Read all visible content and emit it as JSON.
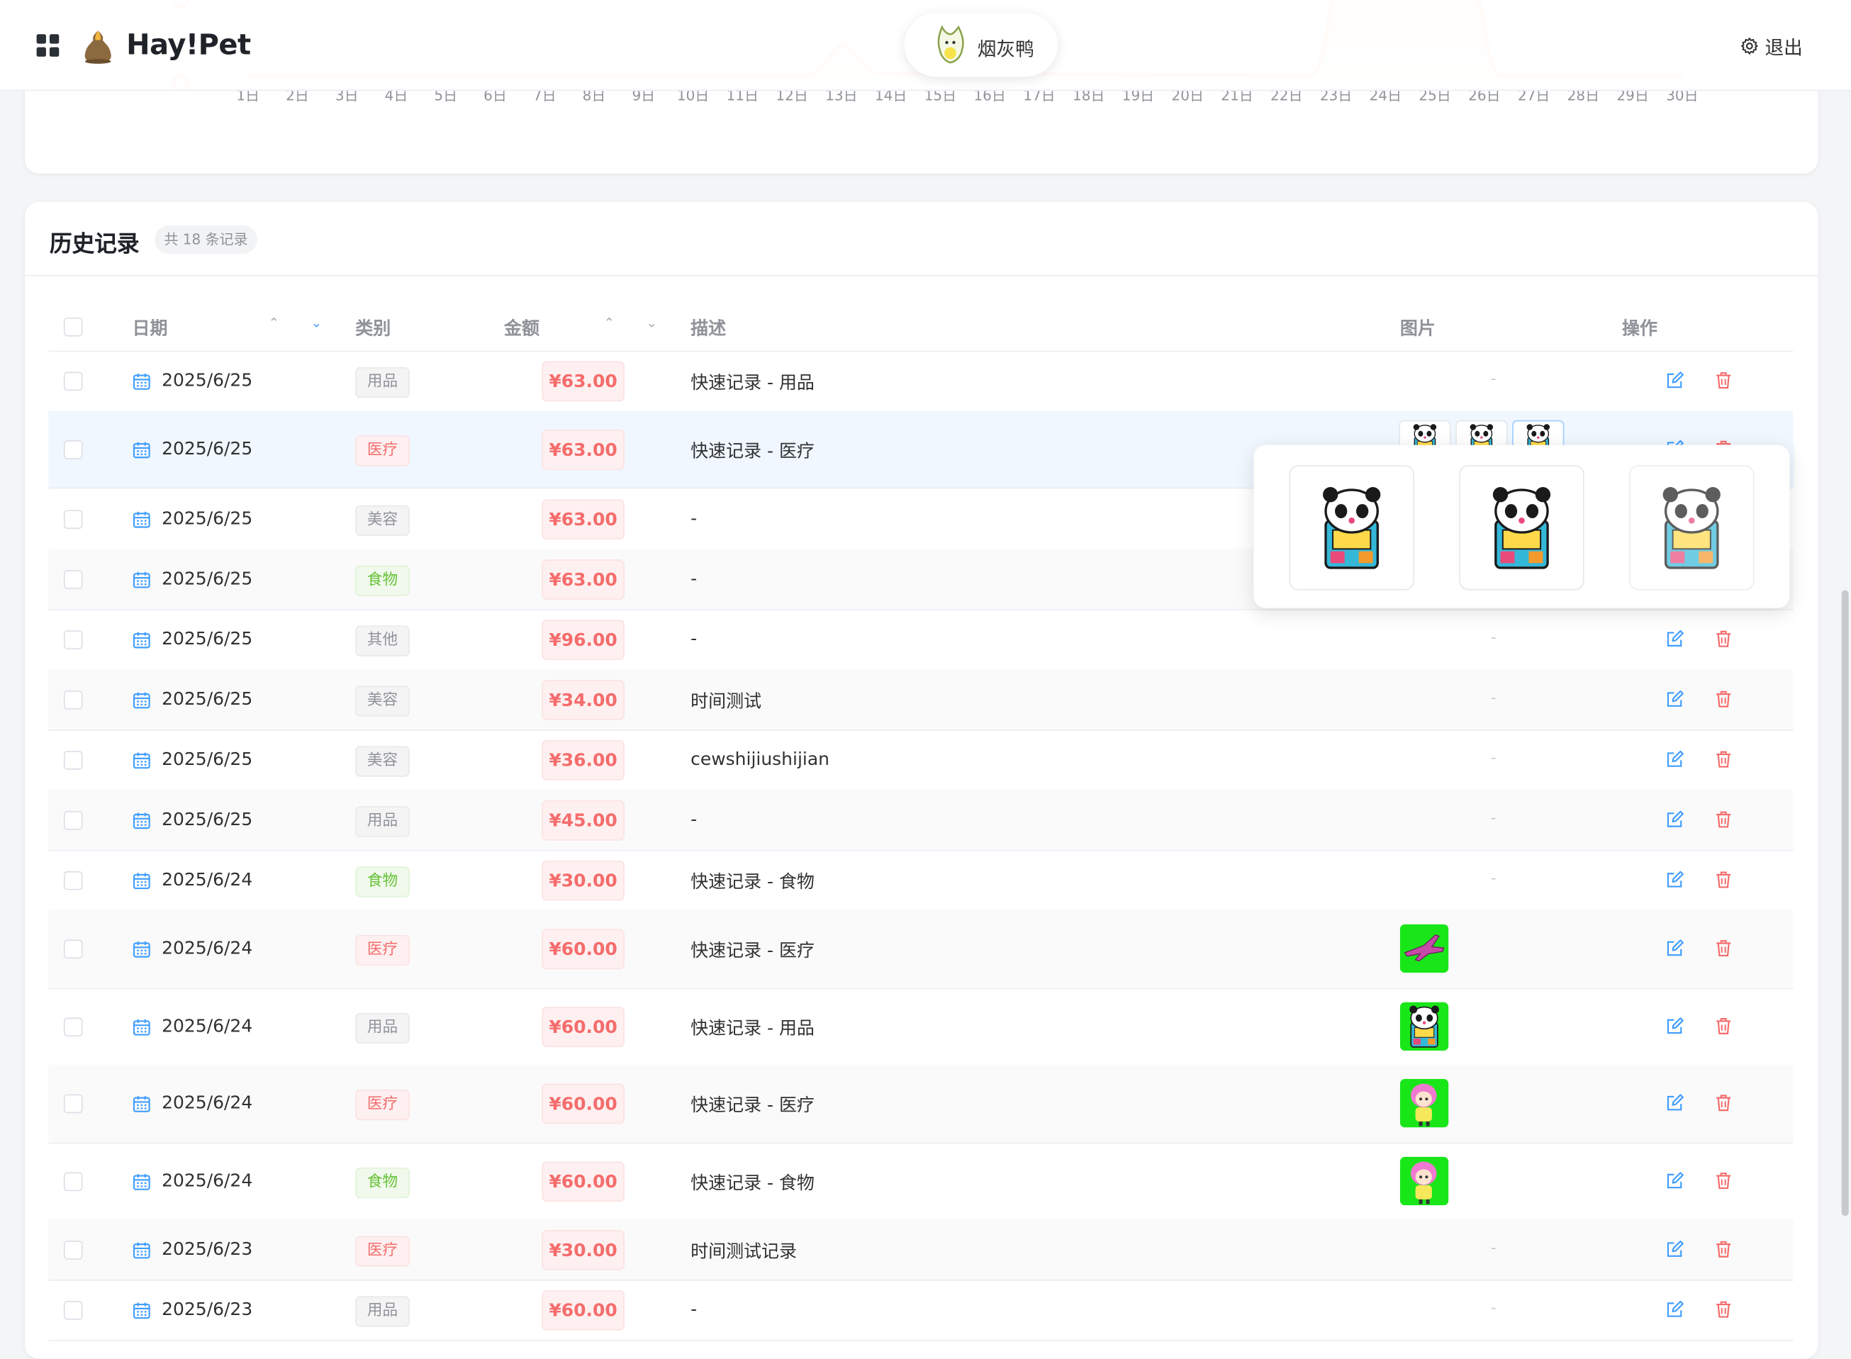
{
  "app": {
    "brand": "Hay!Pet",
    "pet_name": "烟灰鸭",
    "logout_label": "退出"
  },
  "chart_data": {
    "type": "line",
    "x": [
      "1日",
      "2日",
      "3日",
      "4日",
      "5日",
      "6日",
      "7日",
      "8日",
      "9日",
      "10日",
      "11日",
      "12日",
      "13日",
      "14日",
      "15日",
      "16日",
      "17日",
      "18日",
      "19日",
      "20日",
      "21日",
      "22日",
      "23日",
      "24日",
      "25日",
      "26日",
      "27日",
      "28日",
      "29日",
      "30日"
    ],
    "color": "#ff8a3d"
  },
  "history": {
    "title": "历史记录",
    "count_label": "共 18 条记录",
    "columns": {
      "date": "日期",
      "category": "类别",
      "amount": "金额",
      "description": "描述",
      "image": "图片",
      "actions": "操作"
    },
    "rows": [
      {
        "date": "2025/6/25",
        "category": "用品",
        "cat_type": "info",
        "amount": "¥63.00",
        "desc": "快速记录 - 用品",
        "image": "-"
      },
      {
        "date": "2025/6/25",
        "category": "医疗",
        "cat_type": "danger",
        "amount": "¥63.00",
        "desc": "快速记录 - 医疗",
        "image": "3 images"
      },
      {
        "date": "2025/6/25",
        "category": "美容",
        "cat_type": "info",
        "amount": "¥63.00",
        "desc": "-",
        "image": "-"
      },
      {
        "date": "2025/6/25",
        "category": "食物",
        "cat_type": "success",
        "amount": "¥63.00",
        "desc": "-",
        "image": "-"
      },
      {
        "date": "2025/6/25",
        "category": "其他",
        "cat_type": "info",
        "amount": "¥96.00",
        "desc": "-",
        "image": "-"
      },
      {
        "date": "2025/6/25",
        "category": "美容",
        "cat_type": "info",
        "amount": "¥34.00",
        "desc": "时间测试",
        "image": "-"
      },
      {
        "date": "2025/6/25",
        "category": "美容",
        "cat_type": "info",
        "amount": "¥36.00",
        "desc": "cewshijiushijian",
        "image": "-"
      },
      {
        "date": "2025/6/25",
        "category": "用品",
        "cat_type": "info",
        "amount": "¥45.00",
        "desc": "-",
        "image": "-"
      },
      {
        "date": "2025/6/24",
        "category": "食物",
        "cat_type": "success",
        "amount": "¥30.00",
        "desc": "快速记录 - 食物",
        "image": "-"
      },
      {
        "date": "2025/6/24",
        "category": "医疗",
        "cat_type": "danger",
        "amount": "¥60.00",
        "desc": "快速记录 - 医疗",
        "image": "jet-thumb"
      },
      {
        "date": "2025/6/24",
        "category": "用品",
        "cat_type": "info",
        "amount": "¥60.00",
        "desc": "快速记录 - 用品",
        "image": "panda-thumb"
      },
      {
        "date": "2025/6/24",
        "category": "医疗",
        "cat_type": "danger",
        "amount": "¥60.00",
        "desc": "快速记录 - 医疗",
        "image": "girl-thumb"
      },
      {
        "date": "2025/6/24",
        "category": "食物",
        "cat_type": "success",
        "amount": "¥60.00",
        "desc": "快速记录 - 食物",
        "image": "girl-thumb"
      },
      {
        "date": "2025/6/23",
        "category": "医疗",
        "cat_type": "danger",
        "amount": "¥30.00",
        "desc": "时间测试记录",
        "image": "-"
      },
      {
        "date": "2025/6/23",
        "category": "用品",
        "cat_type": "info",
        "amount": "¥60.00",
        "desc": "-",
        "image": "-"
      }
    ]
  },
  "tag_colors": {
    "info": {
      "fg": "#909399",
      "bg": "#f4f4f5",
      "border": "#e9e9eb"
    },
    "danger": {
      "fg": "#f56c6c",
      "bg": "#fef0f0",
      "border": "#fde2e2"
    },
    "success": {
      "fg": "#67c23a",
      "bg": "#f0f9eb",
      "border": "#e1f3d8"
    }
  },
  "accent": "#409eff",
  "danger": "#f56c6c"
}
